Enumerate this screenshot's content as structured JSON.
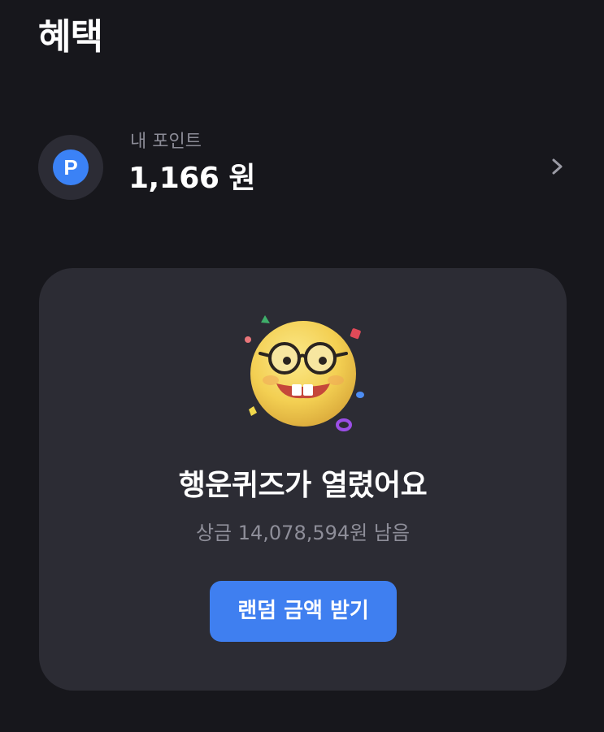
{
  "header": {
    "title": "혜택"
  },
  "points": {
    "icon_letter": "P",
    "label": "내 포인트",
    "value": "1,166 원",
    "icon": "chevron-right-icon",
    "accent": "#3b82f6"
  },
  "quiz": {
    "title": "행운퀴즈가 열렸어요",
    "prize": "상금 14,078,594원 남음",
    "button_label": "랜덤 금액 받기",
    "illustration": "nerd-emoji-illustration",
    "button_color": "#3f7ff0"
  }
}
